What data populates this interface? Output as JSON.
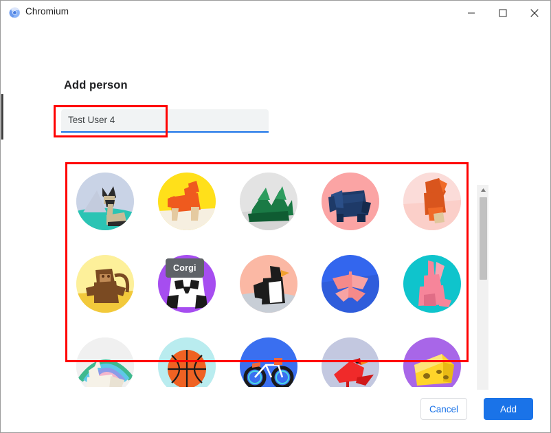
{
  "window": {
    "app_title": "Chromium",
    "app_icon": "chromium-logo-icon",
    "controls": {
      "minimize": "minimize-icon",
      "maximize": "maximize-icon",
      "close": "close-icon"
    }
  },
  "dialog": {
    "title": "Add person",
    "name_input": {
      "value": "Test User 4",
      "placeholder": "Add person"
    },
    "tooltip": "Corgi",
    "scrollbar": {
      "up": "▲",
      "down": "▼"
    },
    "buttons": {
      "cancel": "Cancel",
      "add": "Add"
    }
  },
  "avatars": [
    {
      "name": "Cat",
      "bg": "#c9d3e6",
      "fg": "#cbbb96",
      "accent": "#2bc4b4",
      "dark": "#2b2b2b"
    },
    {
      "name": "Corgi",
      "bg": "#ffe01a",
      "fg": "#ef5a1e",
      "accent": "#f6efe0",
      "dark": "#e5caa0"
    },
    {
      "name": "Dragon",
      "bg": "#e3e3e3",
      "fg": "#1a7a45",
      "accent": "#2d9c5e",
      "dark": "#0f5c32"
    },
    {
      "name": "Elephant",
      "bg": "#fba4a4",
      "fg": "#1e3a68",
      "accent": "#2b4f88",
      "dark": "#152a4d"
    },
    {
      "name": "Fox",
      "bg": "#fbdcd9",
      "fg": "#d9551d",
      "accent": "#f06a28",
      "dark": "#e0c79c"
    },
    {
      "name": "Monkey",
      "bg": "#fdf09a",
      "fg": "#7a4a22",
      "accent": "#f2c93b",
      "dark": "#5c3316"
    },
    {
      "name": "Panda",
      "bg": "#a64df0",
      "fg": "#ffffff",
      "accent": "#1a1a1a",
      "dark": "#111111"
    },
    {
      "name": "Penguin",
      "bg": "#fbb8a4",
      "fg": "#1c1c1c",
      "accent": "#ffffff",
      "dark": "#c8ced6"
    },
    {
      "name": "Butterfly",
      "bg": "#3366ee",
      "fg": "#f58a8a",
      "accent": "#f7a3a3",
      "dark": "#2a52c4"
    },
    {
      "name": "Rabbit",
      "bg": "#0fc4cc",
      "fg": "#f6859a",
      "accent": "#fba3b2",
      "dark": "#e06d86"
    },
    {
      "name": "Unicorn",
      "bg": "#f0f0f0",
      "fg": "#f6f2e8",
      "accent": "#3fb98f",
      "dark": "#d7d7d7"
    },
    {
      "name": "Basketball",
      "bg": "#b9ecef",
      "fg": "#ef6223",
      "accent": "#1a1a1a",
      "dark": "#c94d16"
    },
    {
      "name": "Bicycle",
      "bg": "#3a6ff0",
      "fg": "#ffffff",
      "accent": "#1a1a1a",
      "dark": "#4ad9e0"
    },
    {
      "name": "Bird",
      "bg": "#c3c8e0",
      "fg": "#f02a2a",
      "accent": "#d01818",
      "dark": "#1a1a1a"
    },
    {
      "name": "Cheese",
      "bg": "#a866e8",
      "fg": "#ffd42a",
      "accent": "#f3c21c",
      "dark": "#8a6a12"
    }
  ],
  "colors": {
    "accent_blue": "#1a73e8",
    "annotation_red": "#ff0000",
    "tooltip_bg": "#5f6368",
    "input_bg": "#f1f3f4"
  }
}
